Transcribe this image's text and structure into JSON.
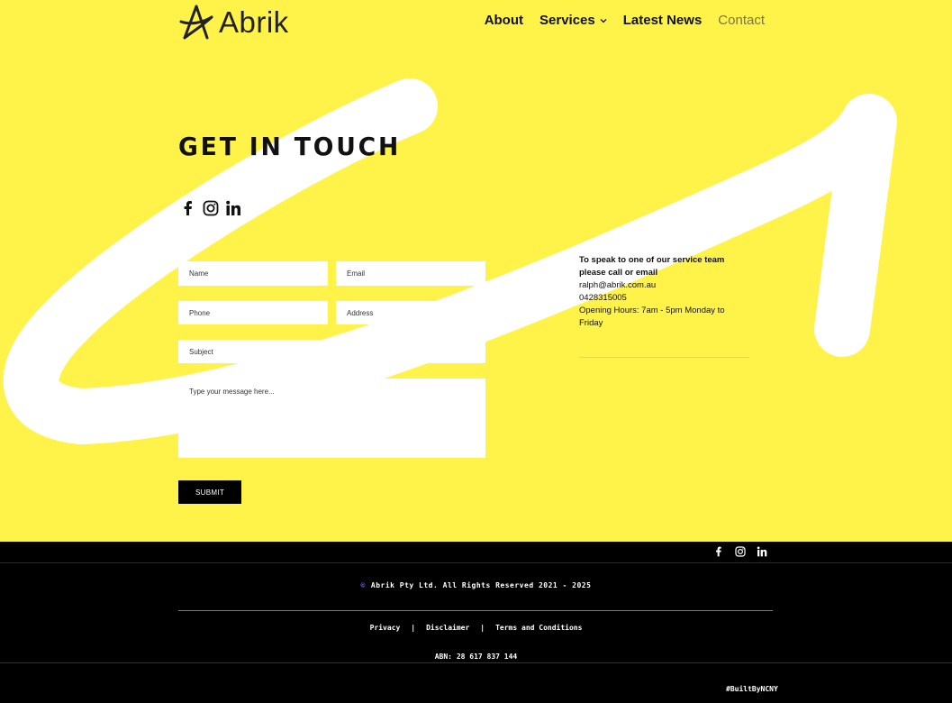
{
  "brand": {
    "name": "Abrik"
  },
  "nav": {
    "items": [
      {
        "label": "About"
      },
      {
        "label": "Services"
      },
      {
        "label": "Latest News"
      },
      {
        "label": "Contact"
      }
    ]
  },
  "contact": {
    "heading": "GET IN TOUCH",
    "social_icons": [
      "facebook-icon",
      "instagram-icon",
      "linkedin-icon"
    ],
    "form": {
      "name_placeholder": "Name",
      "email_placeholder": "Email",
      "phone_placeholder": "Phone",
      "address_placeholder": "Address",
      "subject_placeholder": "Subject",
      "message_placeholder": "Type your message here...",
      "submit_label": "SUBMIT"
    },
    "info": {
      "intro": "To speak to one of our service team please call or email",
      "email": "ralph@abrik.com.au",
      "phone": "0428315005",
      "hours": "Opening Hours: 7am - 5pm Monday to Friday"
    }
  },
  "footer": {
    "copyright": "Abrik Pty Ltd. All Rights Reserved 2021 - 2025",
    "links": [
      "Privacy",
      "Disclaimer",
      "Terms and Conditions"
    ],
    "separator": "|",
    "abn": "ABN: 28 617 837 144",
    "built_by": "#BuiltByNCNY"
  },
  "colors": {
    "background": "#fff34a",
    "footer_bg": "#000000",
    "swoosh": "#ffffff",
    "copyright_icon": "#7d6cff"
  }
}
